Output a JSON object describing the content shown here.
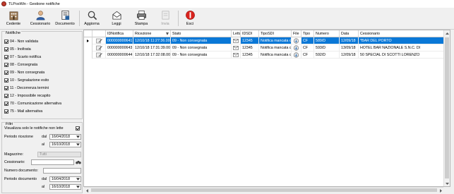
{
  "window": {
    "title": "TLPosWin - Gestione notifiche"
  },
  "toolbar": {
    "cedente": "Cedente",
    "cessionario": "Cessionario",
    "documento": "Documento",
    "aggiorna": "Aggiorna",
    "leggi": "Leggi",
    "stampa": "Stampa",
    "invia": "Invia",
    "esci": "Esci"
  },
  "notifiche": {
    "legend": "Notifiche",
    "items": [
      {
        "label": "04 - Non validata",
        "checked": true
      },
      {
        "label": "05 - Inoltrata",
        "checked": true
      },
      {
        "label": "07 - Scarto notifica",
        "checked": true
      },
      {
        "label": "08 - Consegnata",
        "checked": true
      },
      {
        "label": "09 - Non consegnata",
        "checked": true
      },
      {
        "label": "10 - Segnalazione esito",
        "checked": true
      },
      {
        "label": "11 - Decorrenza termini",
        "checked": true
      },
      {
        "label": "12 - Impossibile recapito",
        "checked": true
      },
      {
        "label": "70 - Comunicazione alternativa",
        "checked": true
      },
      {
        "label": "75 - Mail alternativa",
        "checked": true
      }
    ]
  },
  "filtri": {
    "legend": "Filtri",
    "solo_non_lette": "Visualizza solo le notifiche non lette",
    "solo_non_lette_checked": true,
    "periodo_ricezione": "Periodo ricezione",
    "dal": "dal",
    "al": "al",
    "ricezione_dal": "16/04/2018",
    "ricezione_al": "16/10/2018",
    "magazzino": "Magazzino:",
    "magazzino_value": "Tutti",
    "cessionario": "Cessionario:",
    "cessionario_value": "",
    "numero_documento": "Numero documento:",
    "numero_documento_value": "",
    "periodo_documento": "Periodo documento",
    "documento_dal": "16/04/2018",
    "documento_al": "16/10/2018"
  },
  "grid": {
    "columns": [
      "IDNotifica",
      "Ricezione",
      "Stato",
      "Letta",
      "IDSDI",
      "TipoSDI",
      "File",
      "Tipo",
      "Numero",
      "Data",
      "Cessionario"
    ],
    "rows": [
      {
        "id": "000000000641",
        "ricezione": "12/10/18 11:27:36.000",
        "stato": "09 - Non consegnata",
        "letta": "read",
        "idsdi": "12345",
        "tiposdi": "Notifica mancata co",
        "file": "cloud-icon",
        "tipo": "CF",
        "numero": "589/D",
        "data": "12/09/18",
        "cessionario": "*BAR DEL PORTO",
        "selected": true
      },
      {
        "id": "000000000643",
        "ricezione": "12/10/18 17:31:39.000",
        "stato": "09 - Non consegnata",
        "letta": "read",
        "idsdi": "12345",
        "tiposdi": "Notifica mancata co",
        "file": "cloud-icon",
        "tipo": "CF",
        "numero": "593/D",
        "data": "13/09/18",
        "cessionario": "HOTEL BAR NAZIONALE S.N.C. DI",
        "selected": false
      },
      {
        "id": "000000000644",
        "ricezione": "12/10/18 17:32:08.000",
        "stato": "09 - Non consegnata",
        "letta": "read",
        "idsdi": "12345",
        "tiposdi": "Notifica mancata co",
        "file": "cloud-icon",
        "tipo": "CF",
        "numero": "592/D",
        "data": "12/09/18",
        "cessionario": "50 SPECIAL DI SCOTTI LORENZO",
        "selected": false
      }
    ]
  },
  "colors": {
    "selection": "#0a78d7",
    "esci": "#d9231d"
  }
}
